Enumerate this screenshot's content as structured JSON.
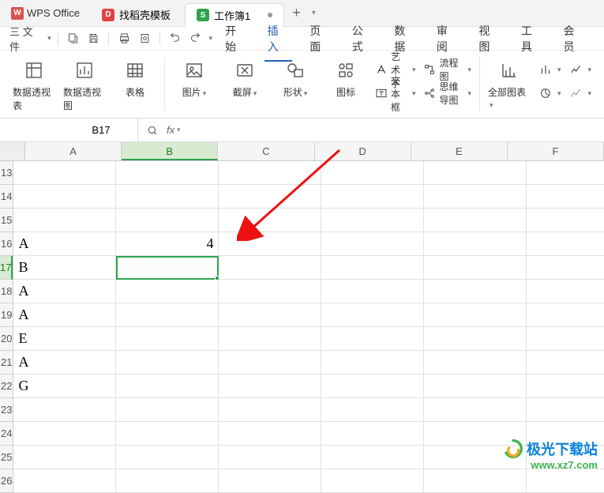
{
  "titlebar": {
    "app_name": "WPS Office",
    "tab1_label": "找稻壳模板",
    "tab2_label": "工作簿1",
    "add_label": "+"
  },
  "quickbar": {
    "file_label": "三 文件"
  },
  "menu": {
    "start": "开始",
    "insert": "插入",
    "page": "页面",
    "formula": "公式",
    "data": "数据",
    "review": "审阅",
    "view": "视图",
    "tools": "工具",
    "vip": "会员"
  },
  "ribbon": {
    "pivot_table": "数据透视表",
    "pivot_chart": "数据透视图",
    "table": "表格",
    "picture": "图片",
    "screenshot": "截屏",
    "shape": "形状",
    "icon": "图标",
    "wordart": "艺术字",
    "textbox": "文本框",
    "flowchart": "流程图",
    "mindmap": "思维导图",
    "all_charts": "全部图表"
  },
  "namebox": {
    "value": "B17"
  },
  "formulabar": {
    "fx": "fx",
    "value": ""
  },
  "columns": [
    "A",
    "B",
    "C",
    "D",
    "E",
    "F"
  ],
  "rows": [
    "13",
    "14",
    "15",
    "16",
    "17",
    "18",
    "19",
    "20",
    "21",
    "22",
    "23",
    "24",
    "25",
    "26"
  ],
  "cells": {
    "A16": "A",
    "B16": "4",
    "A17": "B",
    "A18": "A",
    "A19": "A",
    "A20": "E",
    "A21": "A",
    "A22": "G"
  },
  "selected_cell": "B17",
  "watermark": {
    "cn": "极光下载站",
    "url": "www.xz7.com"
  }
}
